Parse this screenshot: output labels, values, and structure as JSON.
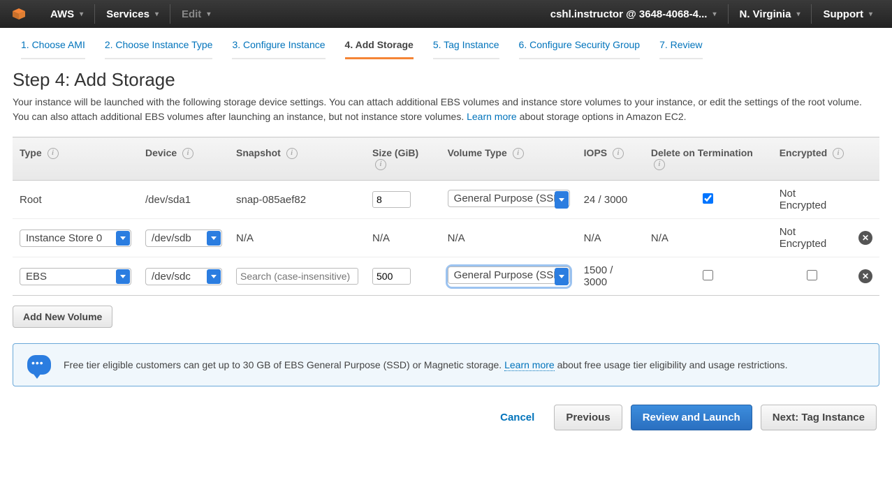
{
  "topnav": {
    "aws": "AWS",
    "services": "Services",
    "edit": "Edit",
    "account": "cshl.instructor @ 3648-4068-4...",
    "region": "N. Virginia",
    "support": "Support"
  },
  "wizard": {
    "tabs": [
      "1. Choose AMI",
      "2. Choose Instance Type",
      "3. Configure Instance",
      "4. Add Storage",
      "5. Tag Instance",
      "6. Configure Security Group",
      "7. Review"
    ],
    "active_index": 3
  },
  "heading": "Step 4: Add Storage",
  "description_1": "Your instance will be launched with the following storage device settings. You can attach additional EBS volumes and instance store volumes to your instance, or edit the settings of the root volume. You can also attach additional EBS volumes after launching an instance, but not instance store volumes. ",
  "description_link": "Learn more",
  "description_2": " about storage options in Amazon EC2.",
  "columns": {
    "type": "Type",
    "device": "Device",
    "snapshot": "Snapshot",
    "size": "Size (GiB)",
    "voltype": "Volume Type",
    "iops": "IOPS",
    "delete": "Delete on Termination",
    "encrypted": "Encrypted"
  },
  "rows": [
    {
      "type_text": "Root",
      "device_text": "/dev/sda1",
      "snapshot": "snap-085aef82",
      "size": "8",
      "voltype": "General Purpose (SSD)",
      "iops": "24 / 3000",
      "delete_checked": true,
      "encrypted": "Not Encrypted"
    },
    {
      "type_select": "Instance Store 0",
      "device_select": "/dev/sdb",
      "snapshot": "N/A",
      "size_text": "N/A",
      "voltype_text": "N/A",
      "iops": "N/A",
      "delete_text": "N/A",
      "encrypted": "Not Encrypted"
    },
    {
      "type_select": "EBS",
      "device_select": "/dev/sdc",
      "snapshot_placeholder": "Search (case-insensitive)",
      "size": "500",
      "voltype": "General Purpose (SSD)",
      "voltype_focused": true,
      "iops": "1500 / 3000",
      "delete_checked": false,
      "encrypted_checkbox": false
    }
  ],
  "add_volume": "Add New Volume",
  "infobox": {
    "text_1": "Free tier eligible customers can get up to 30 GB of EBS General Purpose (SSD) or Magnetic storage. ",
    "link": "Learn more",
    "text_2": " about free usage tier eligibility and usage restrictions."
  },
  "footer": {
    "cancel": "Cancel",
    "previous": "Previous",
    "review": "Review and Launch",
    "next": "Next: Tag Instance"
  }
}
